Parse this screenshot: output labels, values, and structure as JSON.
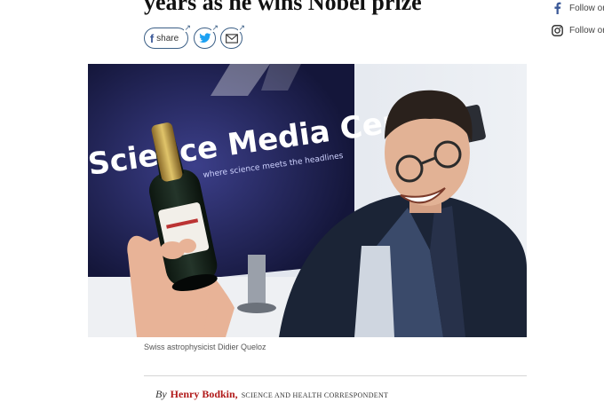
{
  "article": {
    "headline": "years as he wins Nobel prize",
    "caption": "Swiss astrophysicist Didier Queloz",
    "byline": {
      "by": "By",
      "author": "Henry Bodkin,",
      "role": "SCIENCE AND HEALTH CORRESPONDENT"
    }
  },
  "share": {
    "facebook_label": "share",
    "icons": [
      "facebook-icon",
      "twitter-icon",
      "email-icon"
    ]
  },
  "follow": {
    "facebook_label": "Follow or",
    "instagram_label": "Follow or"
  },
  "photo": {
    "sign_text": "Science Media Centre",
    "sign_subtext": "where science meets the headlines"
  },
  "colors": {
    "author": "#b11a1a",
    "share_border": "#3b5f86",
    "twitter": "#1da1f2",
    "facebook": "#3b5998"
  }
}
